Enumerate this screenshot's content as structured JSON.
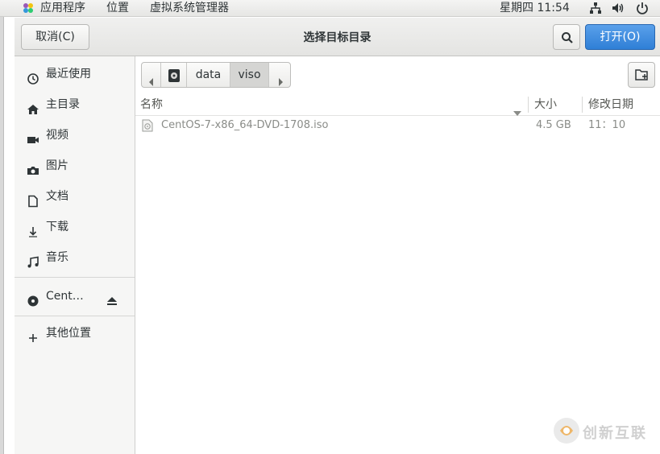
{
  "topbar": {
    "menus": [
      "应用程序",
      "位置",
      "虚拟系统管理器"
    ],
    "clock": "星期四 11:54"
  },
  "header": {
    "cancel_label": "取消(C)",
    "title": "选择目标目录",
    "open_label": "打开(O)"
  },
  "sidebar": {
    "items": [
      {
        "label": "最近使用",
        "icon": "clock-icon"
      },
      {
        "label": "主目录",
        "icon": "home-icon"
      },
      {
        "label": "视频",
        "icon": "video-icon"
      },
      {
        "label": "图片",
        "icon": "camera-icon"
      },
      {
        "label": "文档",
        "icon": "document-icon"
      },
      {
        "label": "下载",
        "icon": "download-icon"
      },
      {
        "label": "音乐",
        "icon": "music-icon"
      }
    ],
    "device": {
      "label": "Cent…",
      "icon": "disc-icon"
    },
    "other": {
      "label": "其他位置",
      "icon": "plus-icon"
    }
  },
  "pathbar": {
    "segments": [
      "data",
      "viso"
    ],
    "active": "viso"
  },
  "list": {
    "columns": {
      "name": "名称",
      "size": "大小",
      "modified": "修改日期"
    },
    "rows": [
      {
        "name": "CentOS-7-x86_64-DVD-1708.iso",
        "size": "4.5 GB",
        "modified": "11：10"
      }
    ]
  },
  "watermark": {
    "text": "创新互联"
  },
  "colors": {
    "accent": "#2f7fd6",
    "sidebar_bg": "#f6f6f5"
  }
}
